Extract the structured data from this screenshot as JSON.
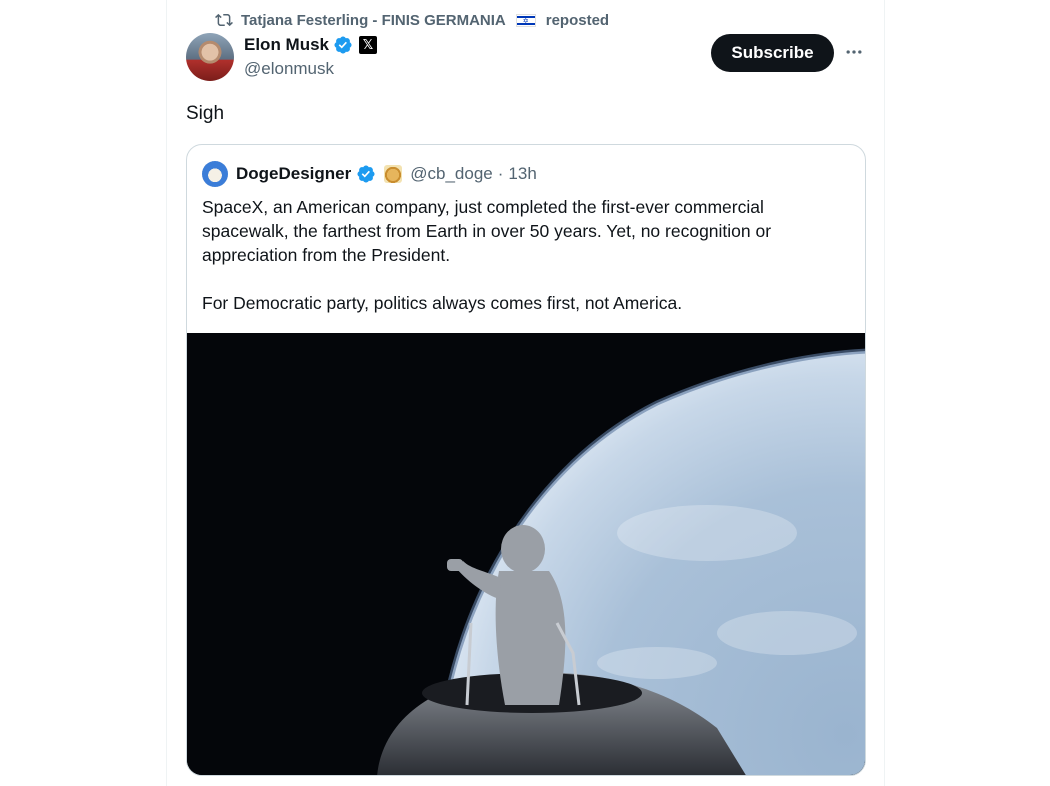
{
  "repost": {
    "user": "Tatjana Festerling - FINIS GERMANIA",
    "flag": "🇮🇱",
    "suffix": "reposted"
  },
  "post": {
    "author_name": "Elon Musk",
    "author_handle": "@elonmusk",
    "verified": true,
    "affiliate_badge": "𝕏",
    "text": "Sigh",
    "subscribe_label": "Subscribe",
    "more_label": "···"
  },
  "quote": {
    "author_name": "DogeDesigner",
    "verified": true,
    "author_handle": "@cb_doge",
    "separator": "·",
    "time": "13h",
    "paragraphs": [
      "SpaceX, an American company, just completed the first-ever commercial spacewalk, the farthest from Earth in over 50 years. Yet, no recognition or appreciation from the President.",
      "For Democratic party, politics always comes first, not America."
    ],
    "media_alt": "Astronaut standing in the open hatch of a spacecraft above Earth"
  },
  "colors": {
    "text_primary": "#0f1419",
    "text_secondary": "#536471",
    "verified_blue": "#1d9bf0",
    "border": "#cfd9de"
  }
}
